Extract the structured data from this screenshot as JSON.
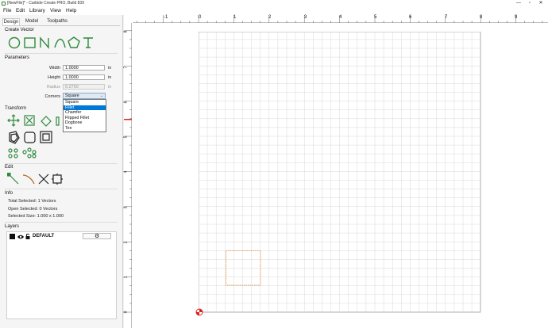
{
  "window": {
    "title": "[NewFile]* - Carbide Create PRO, Build 839",
    "minimize": "—",
    "maximize": "▫",
    "close": "✕"
  },
  "menu": [
    "File",
    "Edit",
    "Library",
    "View",
    "Help"
  ],
  "tabs": [
    "Design",
    "Model",
    "Toolpaths"
  ],
  "create_vector": {
    "heading": "Create Vector",
    "icons": [
      "circle-icon",
      "rectangle-icon",
      "polyline-icon",
      "curve-icon",
      "polygon-icon",
      "text-icon"
    ]
  },
  "parameters": {
    "heading": "Parameters",
    "width_label": "Width",
    "width_value": "1.0000",
    "height_label": "Height",
    "height_value": "1.0000",
    "radius_label": "Radius",
    "radius_value": "0.2750",
    "unit": "in",
    "corners_label": "Corners",
    "corners_selected": "Square",
    "corners_options": [
      "Square",
      "Fillet",
      "Chamfer",
      "Flipped Fillet",
      "Dogbone",
      "Tee"
    ],
    "highlighted_option": "Fillet"
  },
  "transform": {
    "heading": "Transform"
  },
  "edit": {
    "heading": "Edit"
  },
  "info": {
    "heading": "Info",
    "total_selected": "Total Selected:   1 Vectors",
    "open_selected": "Open Selected:   0 Vectors",
    "selected_size": "Selected Size:    1.000 x 1.000"
  },
  "layers": {
    "heading": "Layers",
    "items": [
      {
        "name": "DEFAULT",
        "color": "#111111"
      }
    ]
  },
  "ruler_h": [
    "-1",
    "0",
    "1",
    "2",
    "3",
    "4",
    "5",
    "6",
    "7",
    "8",
    "9"
  ],
  "ruler_v": [
    "8",
    "7",
    "6",
    "5",
    "4",
    "3",
    "2",
    "1",
    "0"
  ],
  "colors": {
    "accent": "#2f8a3c",
    "selection": "#e8893a",
    "origin_marker": "#e02020"
  }
}
